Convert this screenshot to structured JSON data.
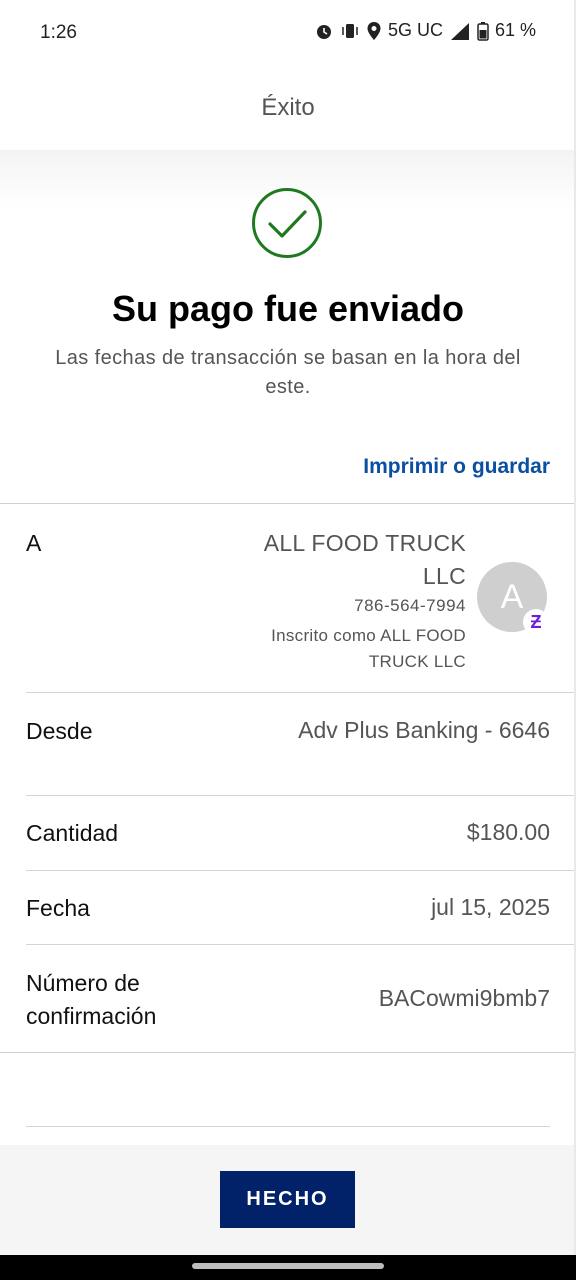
{
  "status_bar": {
    "time": "1:26",
    "network": "5G UC",
    "battery": "61 %"
  },
  "header": {
    "title": "Éxito"
  },
  "confirmation": {
    "title": "Su pago fue enviado",
    "subtitle": "Las fechas de transacción se basan en la hora del este.",
    "print_label": "Imprimir o guardar",
    "accent_color": "#1f7a1f"
  },
  "details": {
    "to": {
      "label": "A",
      "name": "ALL FOOD TRUCK LLC",
      "phone": "786-564-7994",
      "registered": "Inscrito como ALL FOOD TRUCK LLC",
      "avatar_letter": "A",
      "badge_icon": "zelle-icon"
    },
    "from": {
      "label": "Desde",
      "value": "Adv Plus Banking - 6646"
    },
    "amount": {
      "label": "Cantidad",
      "value": "$180.00"
    },
    "date": {
      "label": "Fecha",
      "value": "jul 15, 2025"
    },
    "confirmation_number": {
      "label": "Número de confirmación",
      "value": "BACowmi9bmb7"
    }
  },
  "footer": {
    "done_label": "HECHO",
    "button_color": "#012169"
  }
}
